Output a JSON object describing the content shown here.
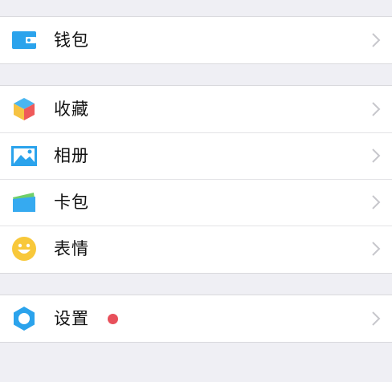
{
  "colors": {
    "background": "#efeff4",
    "row": "#ffffff",
    "chevron": "#c7c7cc",
    "badge": "#e8505b"
  },
  "groups": [
    {
      "items": [
        {
          "label": "钱包",
          "icon": "wallet-icon"
        }
      ]
    },
    {
      "items": [
        {
          "label": "收藏",
          "icon": "favorites-cube-icon"
        },
        {
          "label": "相册",
          "icon": "album-picture-icon"
        },
        {
          "label": "卡包",
          "icon": "card-pack-icon"
        },
        {
          "label": "表情",
          "icon": "smiley-face-icon"
        }
      ]
    },
    {
      "items": [
        {
          "label": "设置",
          "icon": "settings-gear-icon",
          "badge": "red-dot"
        }
      ]
    }
  ]
}
